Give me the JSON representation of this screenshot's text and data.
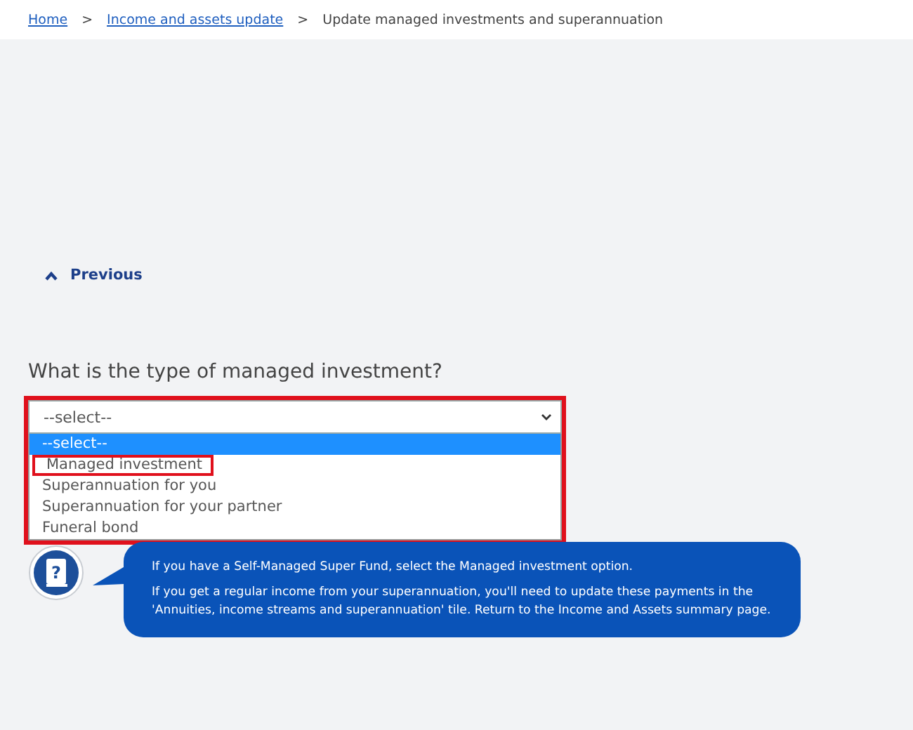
{
  "breadcrumb": [
    {
      "label": "Home",
      "kind": "link"
    },
    {
      "label": "Income and assets update",
      "kind": "link"
    },
    {
      "label": "Update managed investments and superannuation",
      "kind": "current"
    }
  ],
  "breadcrumb_separator": ">",
  "previous_link": {
    "label": "Previous"
  },
  "question": {
    "label": "What is the type of managed investment?"
  },
  "select": {
    "value": "--select--",
    "expanded": true,
    "outlined": true,
    "options": [
      {
        "label": "--select--",
        "selected": true,
        "outlined": false
      },
      {
        "label": "Managed investment",
        "selected": false,
        "outlined": true
      },
      {
        "label": "Superannuation for you",
        "selected": false,
        "outlined": false
      },
      {
        "label": "Superannuation for your partner",
        "selected": false,
        "outlined": false
      },
      {
        "label": "Funeral bond",
        "selected": false,
        "outlined": false
      }
    ]
  },
  "help": {
    "icon_glyph": "?",
    "paragraphs": [
      "If you have a Self-Managed Super Fund, select the Managed investment option.",
      "If you get a regular income from your superannuation, you'll need to update these payments in the 'Annuities, income streams and superannuation' tile. Return to the Income and Assets summary page."
    ]
  }
}
